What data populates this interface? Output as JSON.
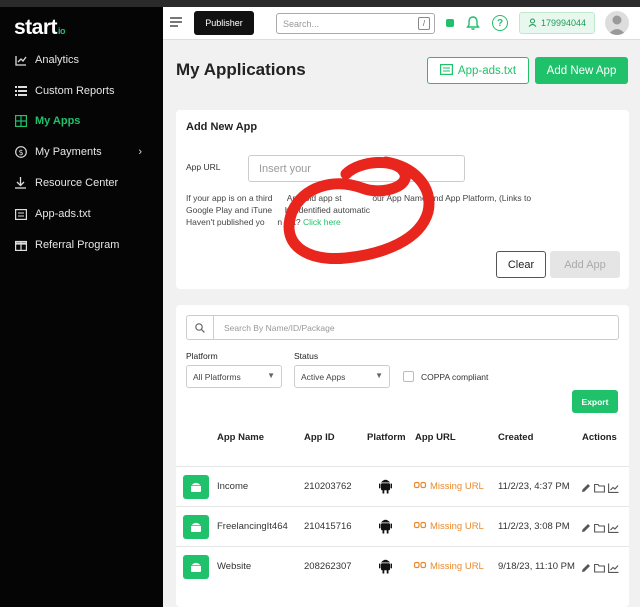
{
  "logo": {
    "main": "start",
    "suffix": "io"
  },
  "sidebar": {
    "items": [
      {
        "label": "Analytics",
        "icon": "line-chart-icon"
      },
      {
        "label": "Custom Reports",
        "icon": "list-icon"
      },
      {
        "label": "My Apps",
        "icon": "grid-icon",
        "active": true
      },
      {
        "label": "My Payments",
        "icon": "dollar-icon"
      },
      {
        "label": "Resource Center",
        "icon": "download-icon"
      },
      {
        "label": "App-ads.txt",
        "icon": "document-icon"
      },
      {
        "label": "Referral Program",
        "icon": "gift-icon"
      }
    ],
    "chevron": "›"
  },
  "header": {
    "publisher_label": "Publisher",
    "search_placeholder": "Search...",
    "search_shortcut": "/",
    "account_id": "179994044"
  },
  "main": {
    "title": "My Applications",
    "appads_label": "App-ads.txt",
    "add_new_label": "Add New App"
  },
  "add_new": {
    "title": "Add New App",
    "url_label": "App URL",
    "url_placeholder": "Insert your",
    "help_line1": "If your app is on a third",
    "help_line1b": "Android app st",
    "help_line1c": "our App Name and App Platform, (Links to",
    "help_line2a": "Google Play and iTune",
    "help_line2b": "be identified automatic",
    "help_line3a": "Haven't published yo",
    "help_line3b": "n yet?",
    "help_link": "Click here",
    "clear_label": "Clear",
    "add_label": "Add App"
  },
  "filters": {
    "search_placeholder": "Search By Name/ID/Package",
    "platform_label": "Platform",
    "platform_value": "All Platforms",
    "status_label": "Status",
    "status_value": "Active Apps",
    "coppa_label": "COPPA compliant",
    "export_label": "Export"
  },
  "table": {
    "headers": [
      "App Name",
      "App ID",
      "Platform",
      "App URL",
      "Created",
      "Actions"
    ],
    "rows": [
      {
        "name": "Income",
        "id": "210203762",
        "url_status": "Missing URL",
        "created": "11/2/23, 4:37 PM"
      },
      {
        "name": "FreelancingIt464",
        "id": "210415716",
        "url_status": "Missing URL",
        "created": "11/2/23, 3:08 PM"
      },
      {
        "name": "Website",
        "id": "208262307",
        "url_status": "Missing URL",
        "created": "9/18/23, 11:10 PM"
      }
    ]
  },
  "colors": {
    "accent": "#1fc16b",
    "warning": "#e88a2c",
    "annotation": "#e8261d",
    "sidebar_bg": "#050505"
  }
}
